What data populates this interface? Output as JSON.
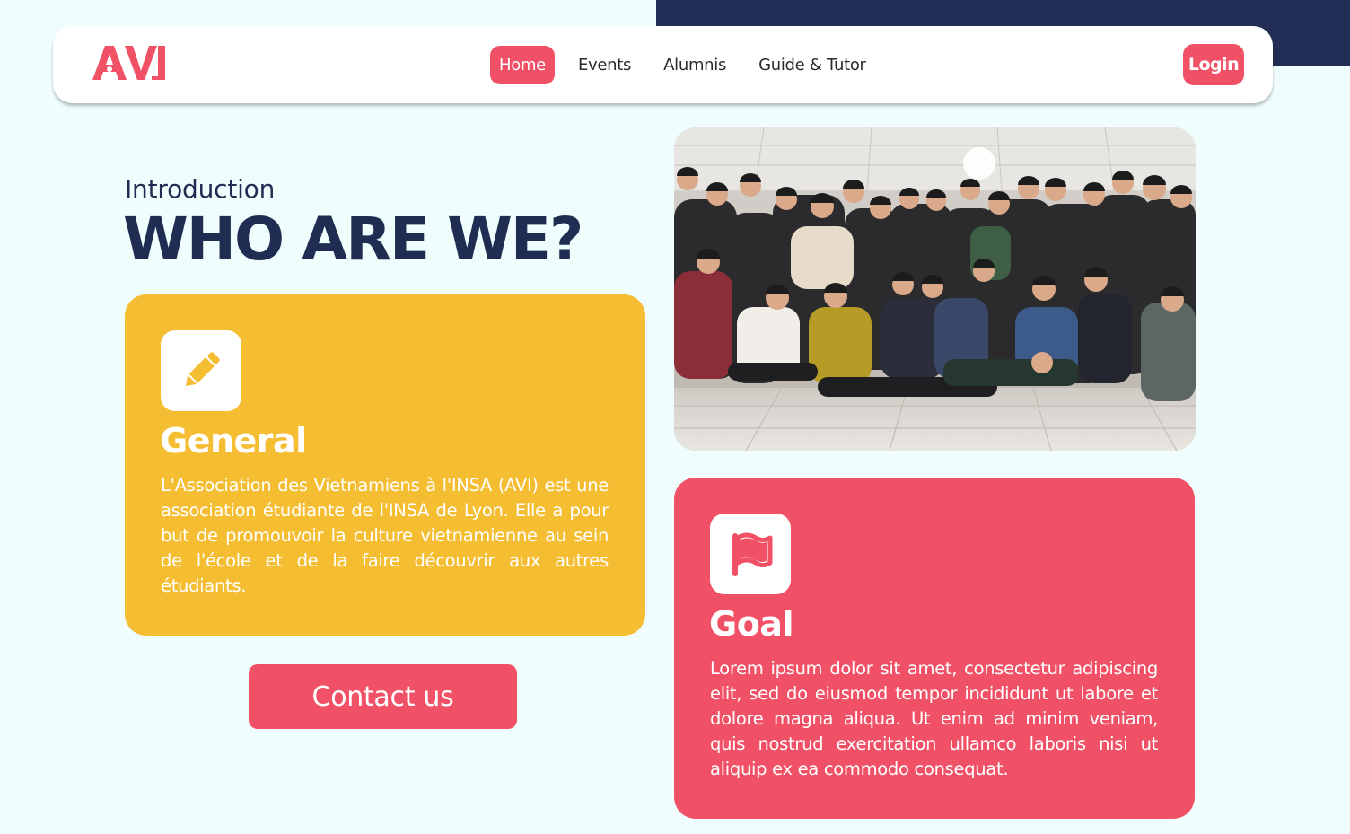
{
  "brand": {
    "logo_text": "AVI",
    "primary_color": "#f15166",
    "accent_yellow": "#f5bd32",
    "navy": "#1f2d52",
    "background": "#effdfd"
  },
  "nav": {
    "items": [
      {
        "label": "Home",
        "active": true
      },
      {
        "label": "Events",
        "active": false
      },
      {
        "label": "Alumnis",
        "active": false
      },
      {
        "label": "Guide & Tutor",
        "active": false
      }
    ],
    "login_label": "Login"
  },
  "hero": {
    "intro_label": "Introduction",
    "title": "WHO ARE WE?",
    "contact_label": "Contact us"
  },
  "cards": {
    "general": {
      "icon": "pencil-icon",
      "title": "General",
      "text": "L'Association des Vietnamiens à l'INSA (AVI) est une association étudiante de l'INSA de Lyon. Elle a pour but de promouvoir la culture vietnamienne au sein de l'école et de la faire découvrir aux autres étudiants."
    },
    "goal": {
      "icon": "flag-icon",
      "title": "Goal",
      "text": "Lorem ipsum dolor sit amet, consectetur adipiscing elit, sed do eiusmod tempor incididunt ut labore et dolore magna aliqua. Ut enim ad minim veniam, quis nostrud exercitation ullamco laboris nisi ut aliquip ex ea commodo consequat."
    }
  },
  "photo": {
    "subject": "group-photo"
  }
}
